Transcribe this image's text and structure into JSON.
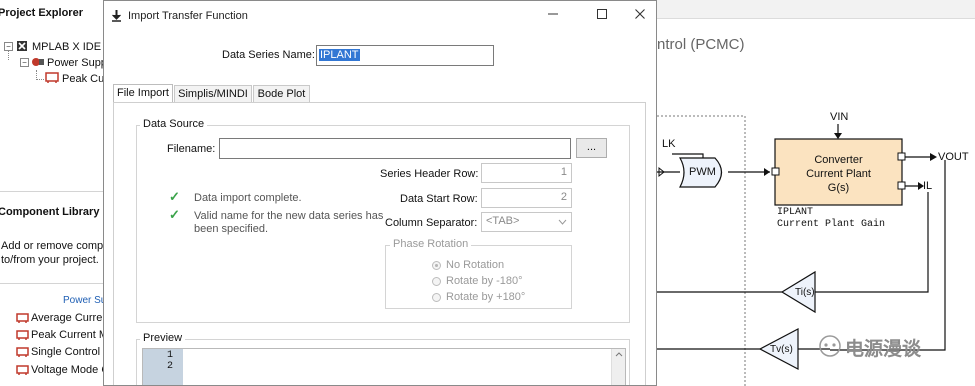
{
  "project_explorer": {
    "title": "Project Explorer",
    "tree": [
      {
        "label": "MPLAB X IDE Pr"
      },
      {
        "label": "Power Supp"
      },
      {
        "label": "Peak Cur"
      }
    ]
  },
  "component_library": {
    "title": "Component Library",
    "description_line1": "Add or remove compo",
    "description_line2": "to/from your project.",
    "category": "Power Sup",
    "items": [
      {
        "label": "Average Curren"
      },
      {
        "label": "Peak Current M"
      },
      {
        "label": "Single Control L"
      },
      {
        "label": "Voltage Mode C"
      }
    ]
  },
  "canvas": {
    "title": "ntrol (PCMC)",
    "clk_label": "LK",
    "pwm_label": "PWM",
    "vin_label": "VIN",
    "plant_line1": "Converter",
    "plant_line2": "Current Plant",
    "plant_line3": "G(s)",
    "vout_label": "VOUT",
    "il_label": "IL",
    "iplant_caption": "IPLANT",
    "iplant_desc": "Current Plant Gain",
    "ti_label": "Ti(s)",
    "tv_label": "Tv(s)",
    "watermark": "电源漫谈"
  },
  "dialog": {
    "title": "Import Transfer Function",
    "data_series_label": "Data Series Name:",
    "data_series_value": "IPLANT",
    "tabs": [
      "File Import",
      "Simplis/MINDI",
      "Bode Plot"
    ],
    "active_tab": "File Import",
    "data_source": {
      "legend": "Data Source",
      "filename_label": "Filename:",
      "filename_value": "",
      "browse_label": "...",
      "status": [
        "Data import complete.",
        "Valid name for the new data series has been specified."
      ],
      "series_header_row_label": "Series Header Row:",
      "series_header_row_value": "1",
      "data_start_row_label": "Data Start Row:",
      "data_start_row_value": "2",
      "column_separator_label": "Column Separator:",
      "column_separator_value": "<TAB>",
      "phase_rotation": {
        "legend": "Phase Rotation",
        "options": [
          "No Rotation",
          "Rotate by -180°",
          "Rotate by +180°"
        ],
        "selected": "No Rotation"
      }
    },
    "preview": {
      "legend": "Preview",
      "line_numbers": [
        "1",
        "2"
      ]
    }
  },
  "colors": {
    "plant_fill": "#fbe3c0",
    "selection": "#3277d4",
    "check_green": "#3aa34a",
    "link_blue": "#1f5fb4"
  }
}
